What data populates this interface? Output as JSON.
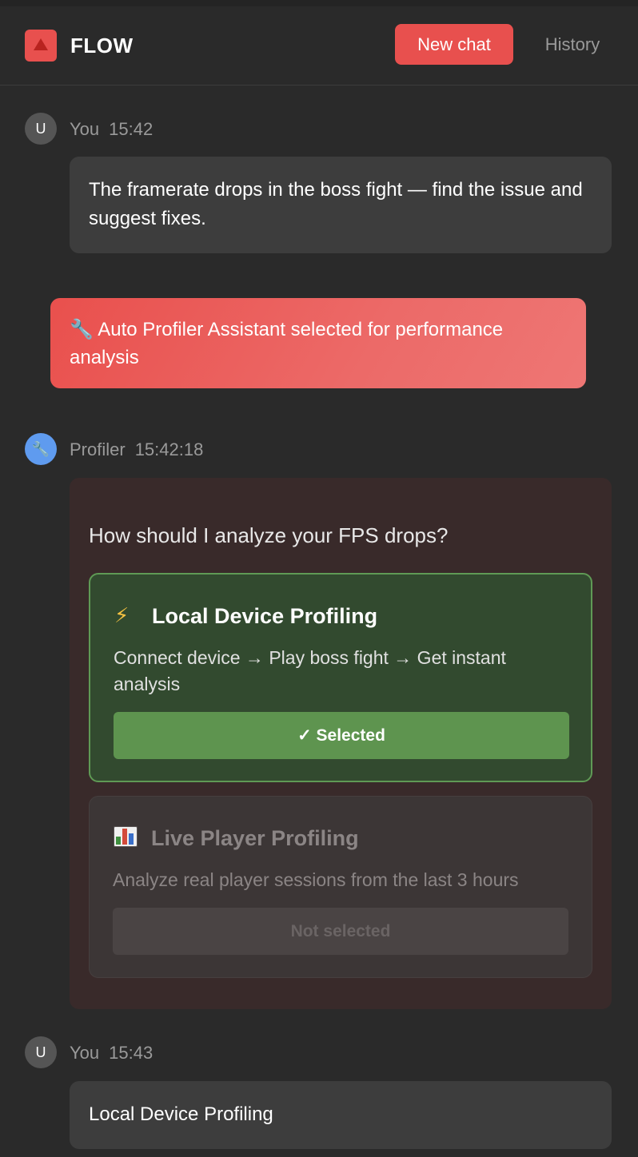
{
  "app": {
    "title": "FLOW"
  },
  "header": {
    "new_chat_label": "New chat",
    "history_label": "History"
  },
  "messages": [
    {
      "author": "You",
      "avatar_letter": "U",
      "time": "15:42",
      "text": "The framerate drops in the boss fight — find the issue and suggest fixes."
    },
    {
      "author": "You",
      "avatar_letter": "U",
      "time": "15:43",
      "text": "Local Device Profiling"
    }
  ],
  "notice": {
    "icon": "wrench-icon",
    "text": "🔧 Auto Profiler Assistant selected for performance analysis"
  },
  "profiler": {
    "author": "Profiler",
    "time": "15:42:18",
    "avatar_icon": "wrench-icon",
    "question": "How should I analyze your FPS drops?",
    "options": [
      {
        "icon": "lightning-icon",
        "icon_glyph": "⚡",
        "title": "Local Device Profiling",
        "description": "Connect device → Play boss fight → Get instant analysis",
        "button_label": "✓ Selected",
        "selected": true
      },
      {
        "icon": "bar-chart-icon",
        "title": "Live Player Profiling",
        "description": "Analyze real player sessions from the last 3 hours",
        "button_label": "Not selected",
        "selected": false
      }
    ]
  },
  "colors": {
    "accent": "#e8504e",
    "selected_green": "#5e944f",
    "bot_avatar": "#5f9bef"
  }
}
